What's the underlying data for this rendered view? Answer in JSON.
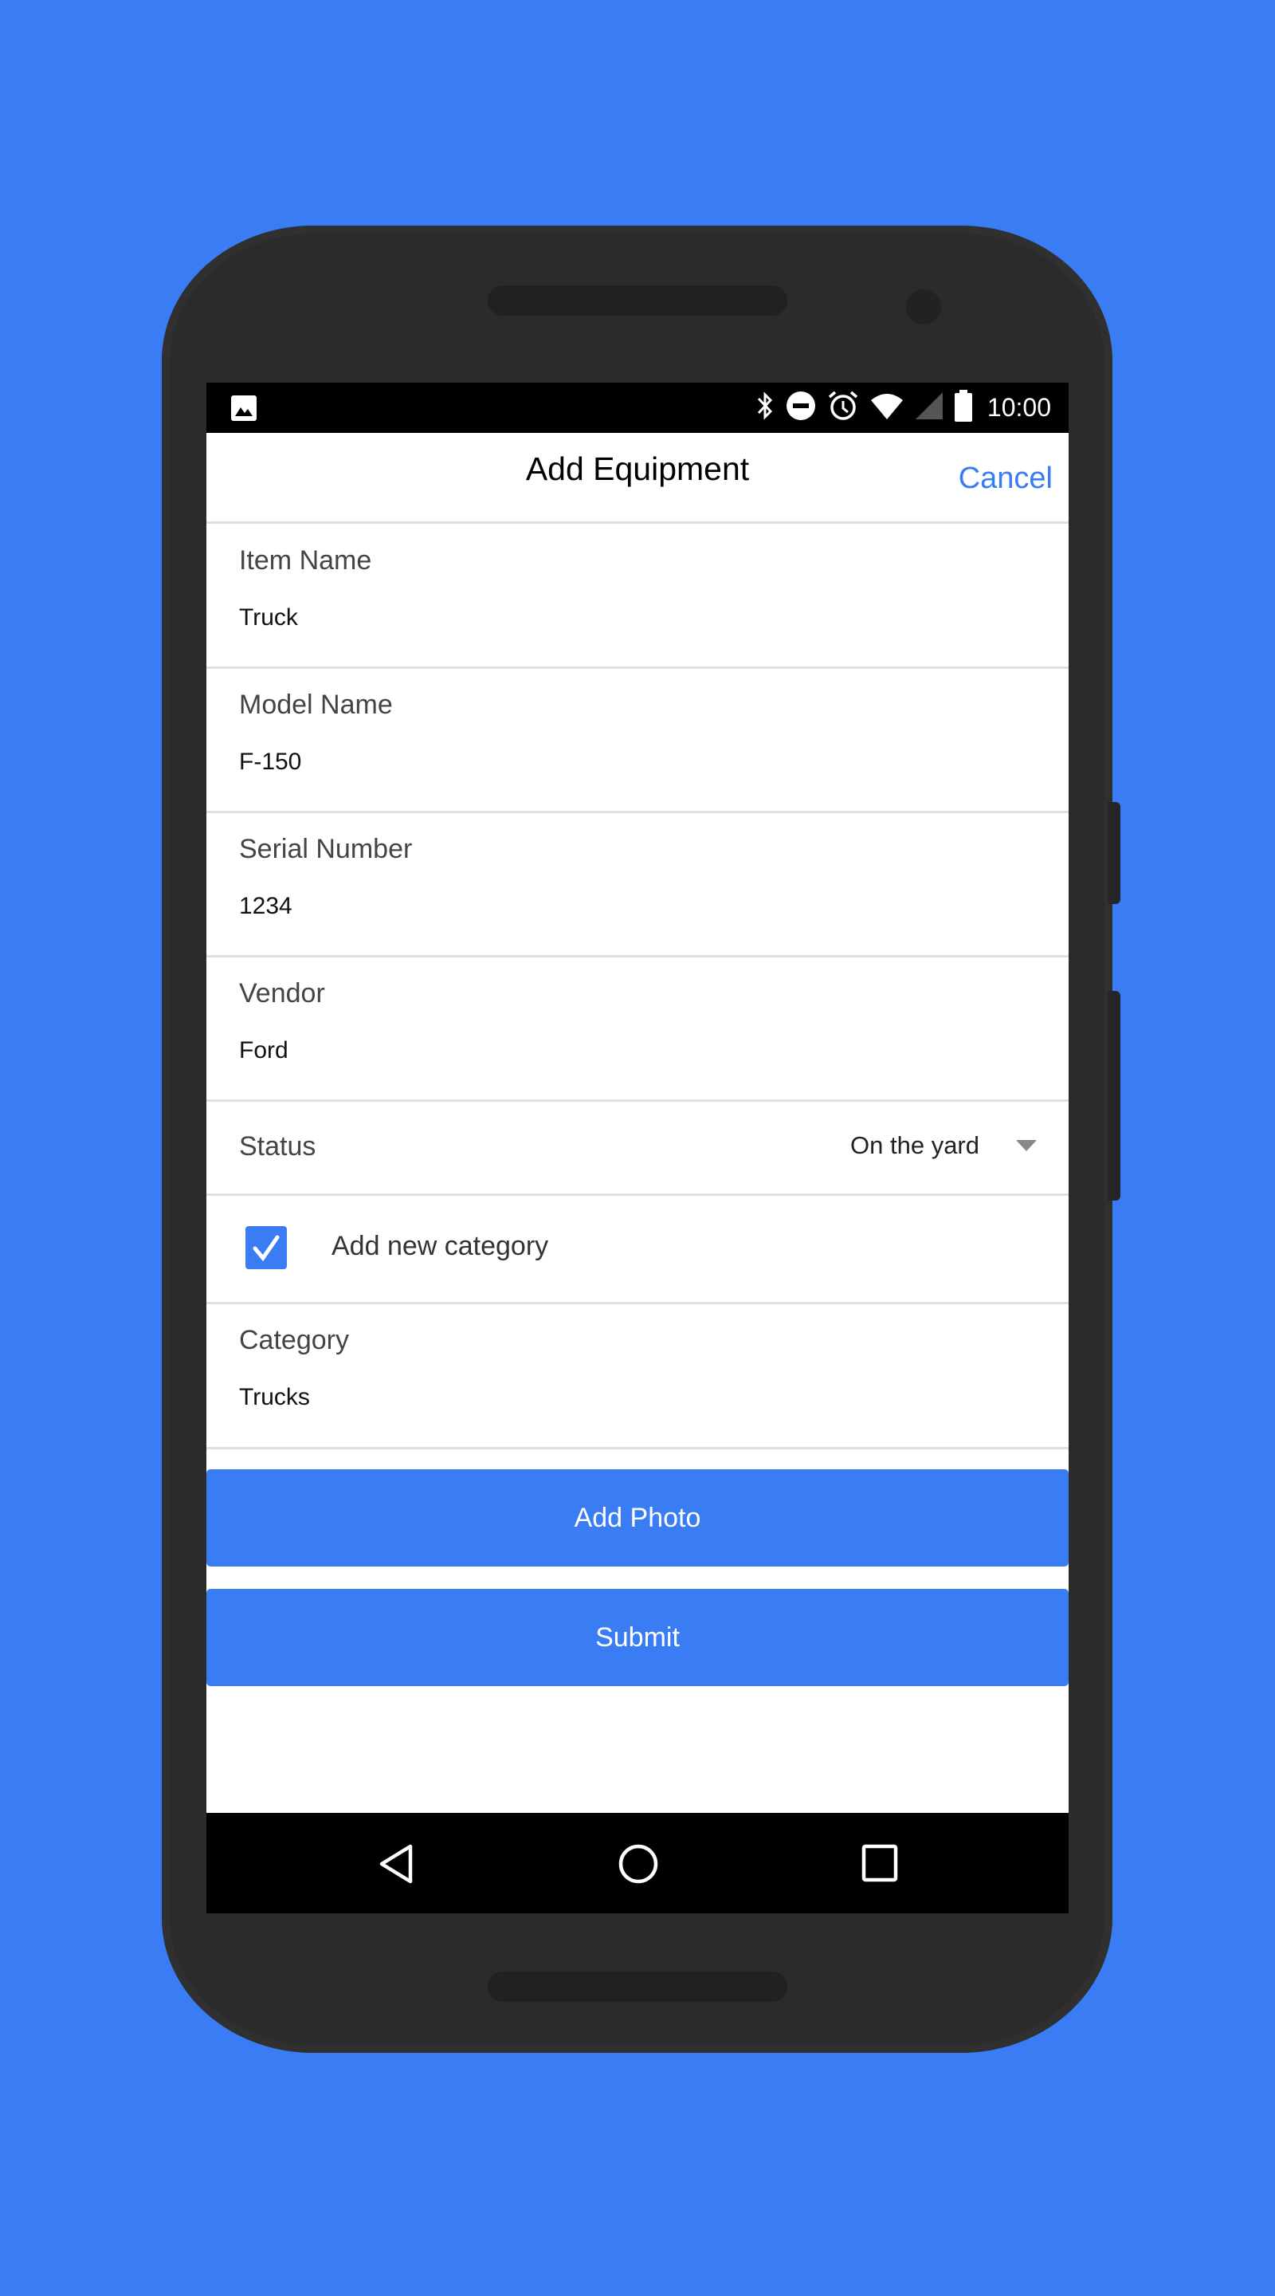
{
  "status_bar": {
    "icons": [
      "image-icon",
      "bluetooth-icon",
      "do-not-disturb-icon",
      "alarm-icon",
      "wifi-icon",
      "signal-icon",
      "battery-icon"
    ],
    "time": "10:00"
  },
  "header": {
    "title": "Add Equipment",
    "cancel_label": "Cancel"
  },
  "form": {
    "fields": [
      {
        "label": "Item Name",
        "value": "Truck"
      },
      {
        "label": "Model Name",
        "value": "F-150"
      },
      {
        "label": "Serial Number",
        "value": "1234"
      },
      {
        "label": "Vendor",
        "value": "Ford"
      }
    ],
    "status": {
      "label": "Status",
      "selected": "On the yard"
    },
    "add_category": {
      "label": "Add new category",
      "checked": true
    },
    "category": {
      "label": "Category",
      "value": "Trucks"
    }
  },
  "buttons": {
    "add_photo": "Add Photo",
    "submit": "Submit"
  },
  "nav_bar": {
    "icons": [
      "back-icon",
      "home-icon",
      "recents-icon"
    ]
  },
  "colors": {
    "background": "#3a7cf3",
    "accent": "#3a7cf3",
    "phone_body": "#2b2b2b"
  }
}
